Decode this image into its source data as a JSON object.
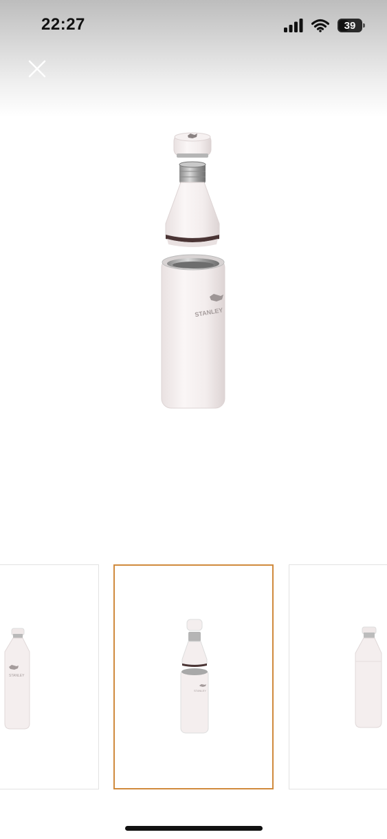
{
  "status_bar": {
    "time": "22:27",
    "battery_level": "39",
    "icons": [
      "signal-icon",
      "wifi-icon",
      "battery-icon"
    ]
  },
  "viewer": {
    "close_icon": "close-icon",
    "main_image": {
      "subject": "white insulated bottle, exploded view",
      "brand_text": "STANLEY"
    },
    "thumbnails": [
      {
        "view": "assembled-side",
        "brand_text": "STANLEY",
        "selected": false
      },
      {
        "view": "exploded",
        "brand_text": "STANLEY",
        "selected": true
      },
      {
        "view": "assembled-back",
        "selected": false
      }
    ]
  },
  "colors": {
    "selected_border": "#d08a3c",
    "bottle_body": "#f4eeee"
  }
}
